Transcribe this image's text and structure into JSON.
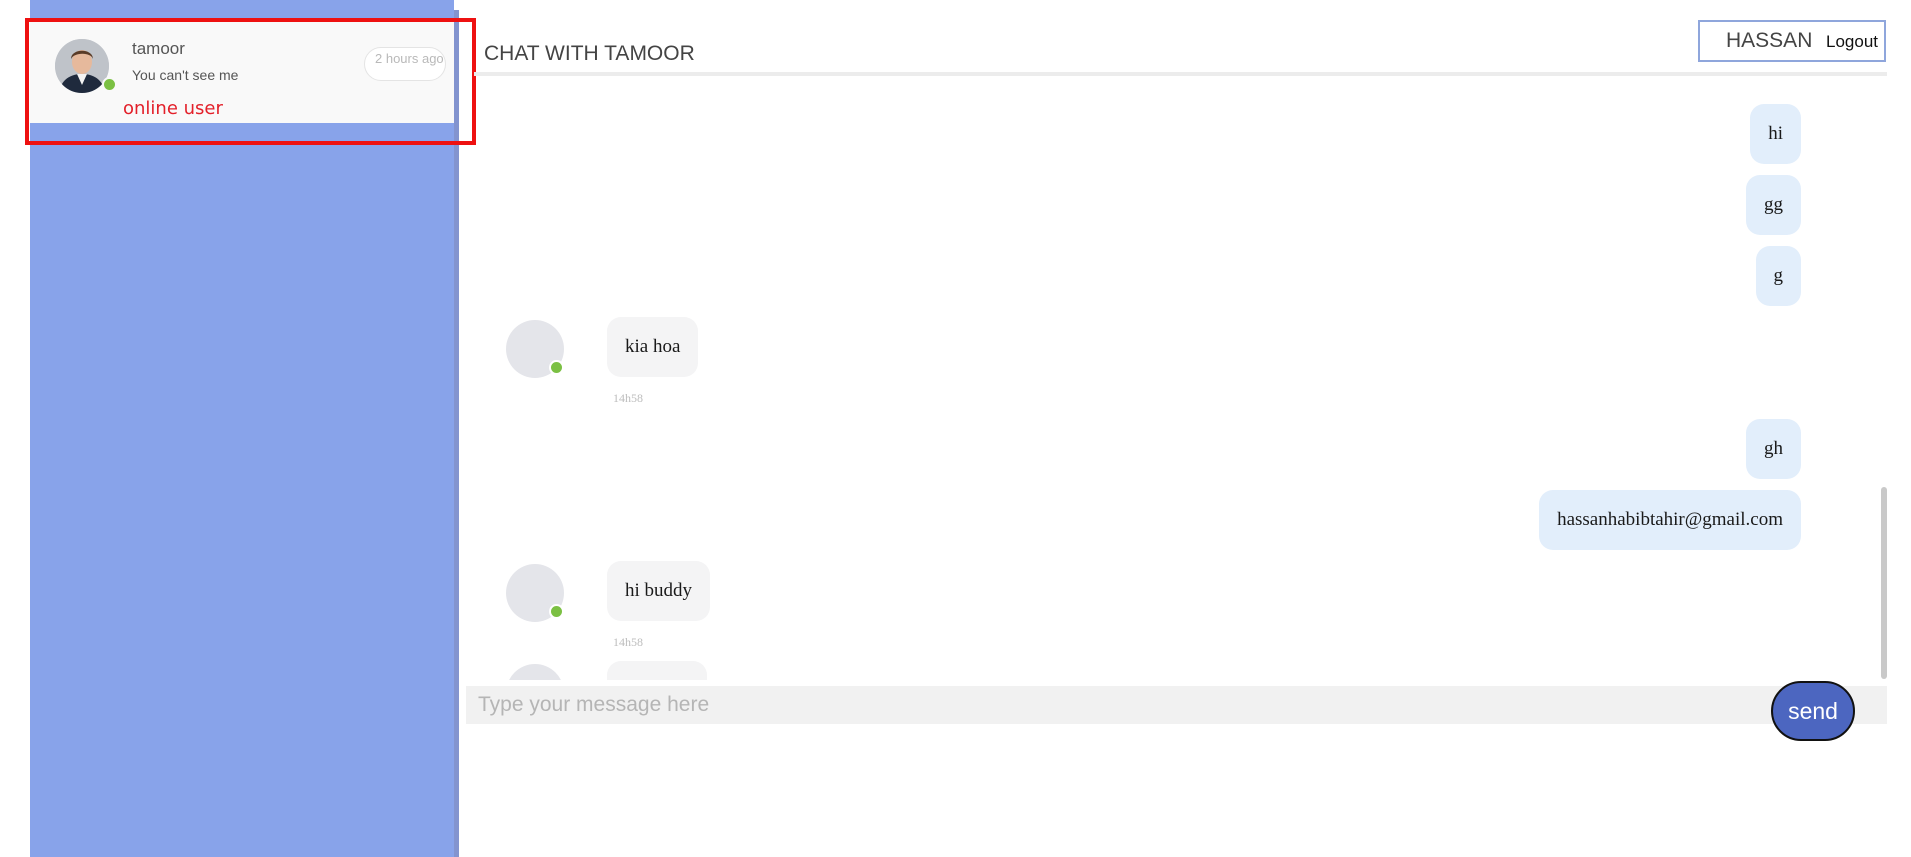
{
  "sidebar": {
    "contact": {
      "name": "tamoor",
      "preview": "You can't see me",
      "time": "2 hours ago",
      "status_label": "online user"
    }
  },
  "header": {
    "title": "CHAT WITH TAMOOR",
    "user_name": "HASSAN",
    "logout_label": "Logout"
  },
  "messages": [
    {
      "direction": "out",
      "text": "hi"
    },
    {
      "direction": "out",
      "text": "gg"
    },
    {
      "direction": "out",
      "text": "g"
    },
    {
      "direction": "in",
      "text": "kia hoa",
      "time": "14h58"
    },
    {
      "direction": "out",
      "text": "gh"
    },
    {
      "direction": "out",
      "text": "hassanhabibtahir@gmail.com"
    },
    {
      "direction": "in",
      "text": "hi buddy",
      "time": "14h58"
    }
  ],
  "composer": {
    "placeholder": "Type your message here",
    "send_label": "send"
  },
  "colors": {
    "sidebar_bg": "#88a3ea",
    "online_green": "#7bc043",
    "highlight_red": "#ee1111",
    "send_button": "#4c66c0",
    "outgoing_bubble": "#e2eefb",
    "incoming_bubble": "#f4f4f5"
  }
}
